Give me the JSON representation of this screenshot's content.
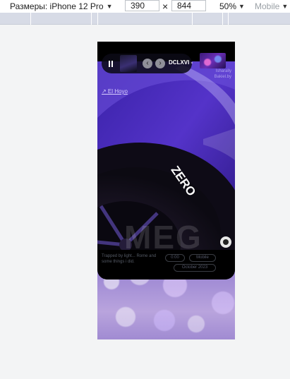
{
  "devtools": {
    "device_label": "Размеры: iPhone 12 Pro",
    "width_value": "390",
    "height_value": "844",
    "times_symbol": "×",
    "zoom_label": "50%",
    "mode_label": "Mobile",
    "caret": "▼"
  },
  "player": {
    "state": "paused",
    "prev_symbol": "‹",
    "next_symbol": "›",
    "track_title": "DCLXVI -"
  },
  "artwork": {
    "credit_link": "↗ El Hoyo",
    "brand_lines": [
      "Isharally",
      "Bakiel.by"
    ],
    "watermark": "MEG",
    "tire_brand_text": "ZERO"
  },
  "info": {
    "description": "Trapped by light... Rome and some things i did.",
    "tags": [
      "0:00",
      "Mobile",
      "October 2023"
    ]
  },
  "colors": {
    "accent": "#5b3fd0",
    "background": "#f3f4f5"
  }
}
